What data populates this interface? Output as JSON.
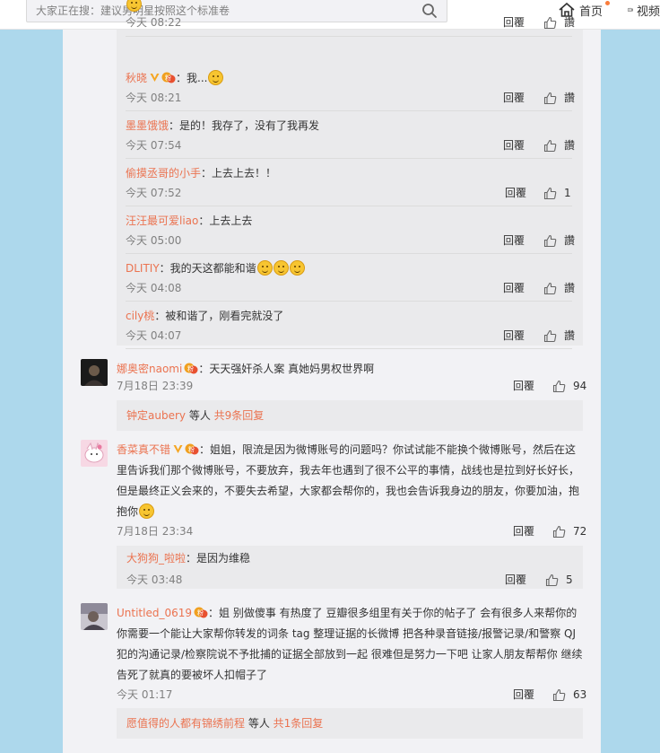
{
  "header": {
    "search_placeholder": "大家正在搜：建议男明星按照这个标准卷",
    "nav_home": "首页",
    "nav_video": "视频"
  },
  "labels": {
    "reply": "回覆",
    "like": "讚"
  },
  "sub_comments": [
    {
      "nick": "",
      "text": "",
      "time": "今天 08:22",
      "likes": "讚"
    },
    {
      "nick": "秋晓",
      "text": "：我...",
      "time": "今天 08:21",
      "likes": "讚"
    },
    {
      "nick": "墨墨饿饿",
      "text": "：是的！我存了，没有了我再发",
      "time": "今天 07:54",
      "likes": "讚"
    },
    {
      "nick": "偷摸丞哥的小手",
      "text": "：上去上去！！",
      "time": "今天 07:52",
      "likes": "1"
    },
    {
      "nick": "汪汪最可爱liao",
      "text": "：上去上去",
      "time": "今天 05:00",
      "likes": "讚"
    },
    {
      "nick": "DLITIY",
      "text": "：我的天这都能和谐",
      "time": "今天 04:08",
      "likes": "讚"
    },
    {
      "nick": "cily桃",
      "text": "：被和谐了，刚看完就没了",
      "time": "今天 04:07",
      "likes": "讚"
    }
  ],
  "comments": [
    {
      "nick": "娜奥密naomi",
      "text": "：天天强奸杀人案 真她妈男权世界啊",
      "time": "7月18日 23:39",
      "likes": "94",
      "more_nick": "钟定aubery",
      "more_mid": " 等人 ",
      "more_link": "共9条回复"
    },
    {
      "nick": "香菜真不错",
      "text": "：姐姐，限流是因为微博账号的问题吗？你试试能不能换个微博账号，然后在这里告诉我们那个微博账号，不要放弃，我去年也遇到了很不公平的事情，战线也是拉到好长好长，但是最终正义会来的，不要失去希望，大家都会帮你的，我也会告诉我身边的朋友，你要加油，抱抱你",
      "time": "7月18日 23:34",
      "likes": "72",
      "sub_nick": "大狗狗_啦啦",
      "sub_text": "：是因为维稳",
      "sub_time": "今天 03:48",
      "sub_likes": "5"
    },
    {
      "nick": "Untitled_0619",
      "text": "：姐 别做傻事 有热度了 豆瓣很多组里有关于你的帖子了 会有很多人来帮你的 你需要一个能让大家帮你转发的词条 tag 整理证据的长微博 把各种录音链接/报警记录/和警察 QJ犯的沟通记录/检察院说不予批捕的证据全部放到一起 很难但是努力一下吧 让家人朋友帮帮你 继续告死了就真的要被坏人扣帽子了",
      "time": "今天 01:17",
      "likes": "63",
      "more_nick": "愿值得的人都有锦绣前程",
      "more_mid": " 等人 ",
      "more_link": "共1条回复"
    }
  ],
  "colors": {
    "nick": "#eb7350",
    "panel": "#f2f2f5",
    "background": "#add8ec"
  }
}
